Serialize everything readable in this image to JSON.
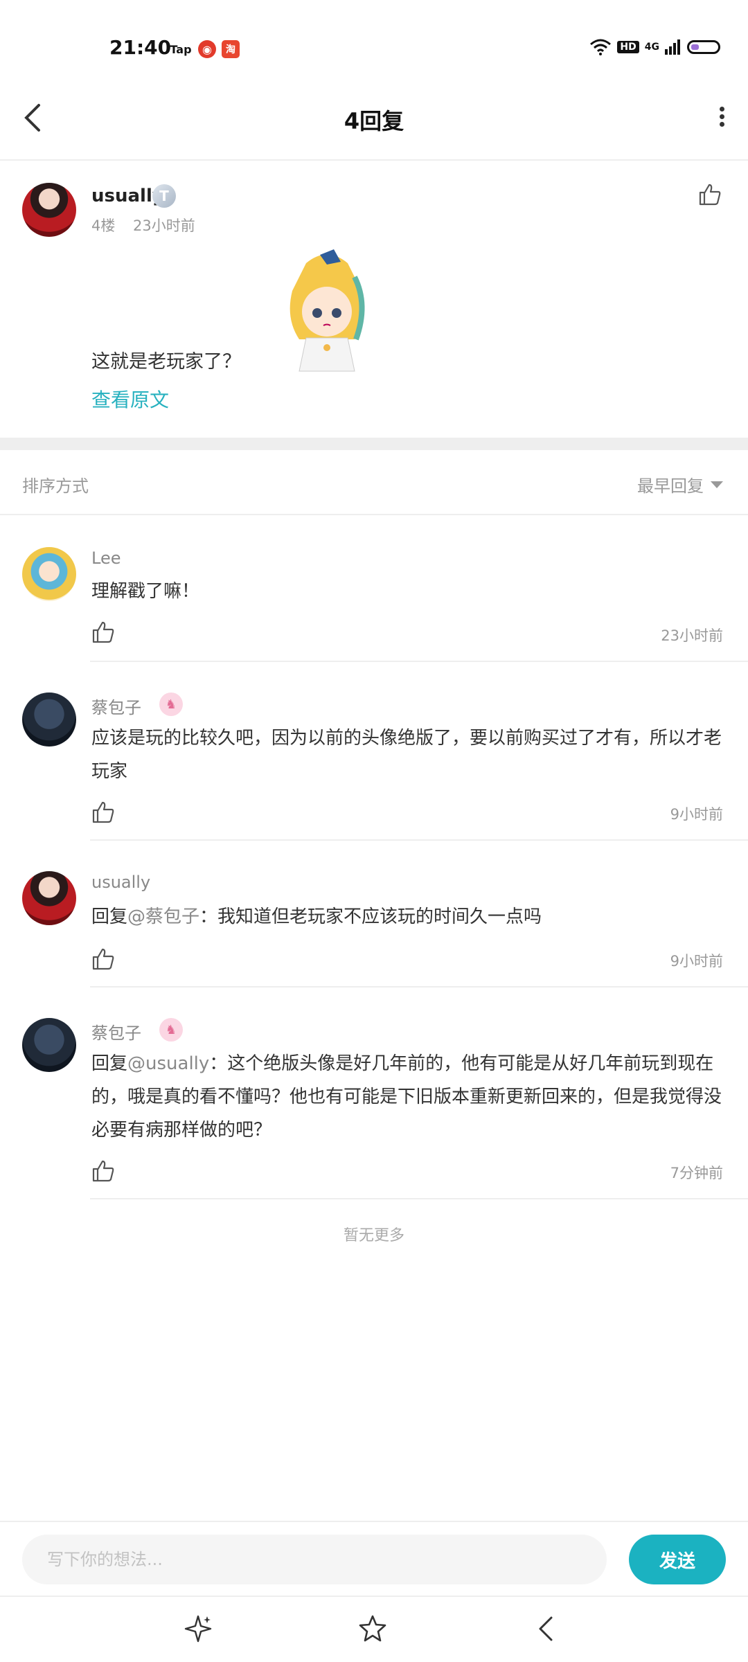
{
  "status_bar": {
    "time": "21:40",
    "tap_label": "Tap",
    "taobao_label": "淘",
    "hd_label": "HD",
    "network_label": "4G",
    "battery_level": 0.3
  },
  "nav": {
    "title": "4回复"
  },
  "post": {
    "username": "usually",
    "badge_letter": "T",
    "floor": "4楼",
    "time": "23小时前",
    "text": "这就是老玩家了？",
    "view_original": "查看原文"
  },
  "sort": {
    "label": "排序方式",
    "value": "最早回复"
  },
  "comments": [
    {
      "name": "Lee",
      "text": "理解戳了嘛！",
      "time": "23小时前"
    },
    {
      "name": "蔡包子",
      "text": "应该是玩的比较久吧，因为以前的头像绝版了，要以前购买过了才有，所以才老玩家",
      "time": "9小时前"
    },
    {
      "name": "usually",
      "reply_prefix": "回复",
      "mention": "@蔡包子",
      "text": "：我知道但老玩家不应该玩的时间久一点吗",
      "time": "9小时前"
    },
    {
      "name": "蔡包子",
      "reply_prefix": "回复",
      "mention": "@usually",
      "text": "：这个绝版头像是好几年前的，他有可能是从好几年前玩到现在的，哦是真的看不懂吗？他也有可能是下旧版本重新更新回来的，但是我觉得没必要有病那样做的吧？",
      "time": "7分钟前"
    }
  ],
  "footer": {
    "no_more": "暂无更多",
    "input_placeholder": "写下你的想法...",
    "send_label": "发送"
  },
  "colors": {
    "accent": "#1bb2c1",
    "link": "#27b1bf"
  },
  "icons": [
    "back-icon",
    "more-icon",
    "like-icon",
    "sparkle-icon",
    "star-icon",
    "nav-back-icon"
  ]
}
